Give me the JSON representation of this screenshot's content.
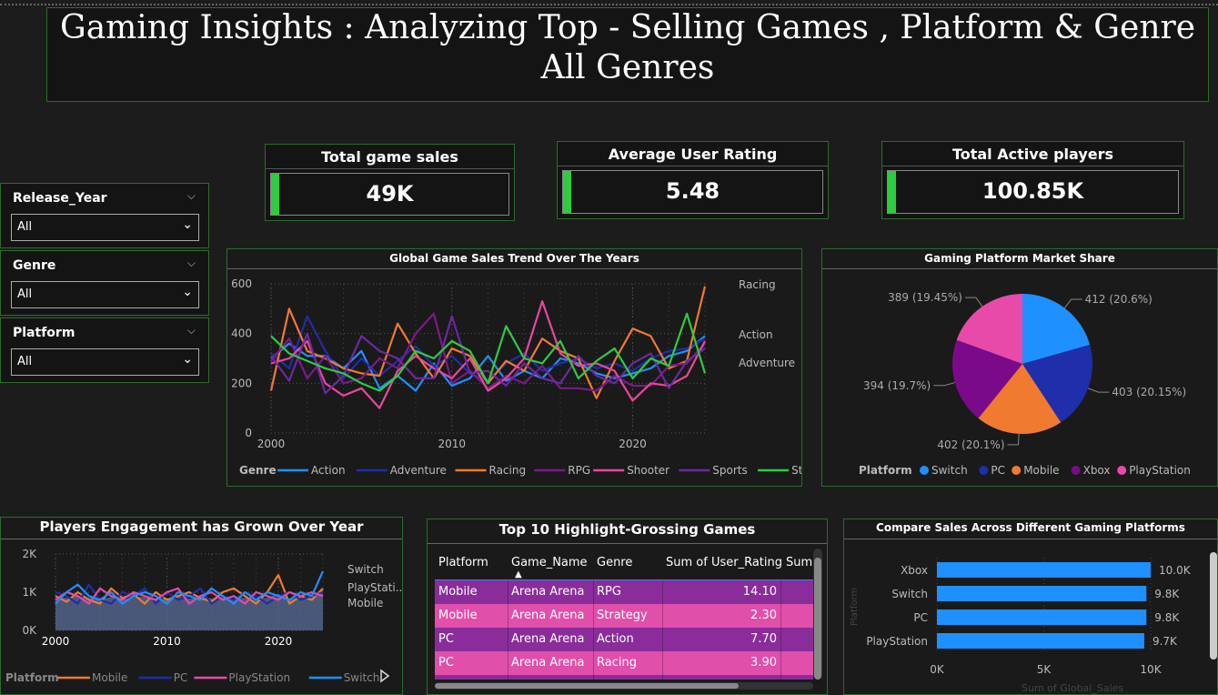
{
  "header": {
    "title_line1": "Gaming Insights : Analyzing Top - Selling Games , Platform & Genre",
    "title_line2": "All Genres"
  },
  "kpis": [
    {
      "label": "Total game sales",
      "value": "49K",
      "accent": "#2ecc40"
    },
    {
      "label": "Average User Rating",
      "value": "5.48",
      "accent": "#2ecc40"
    },
    {
      "label": "Total Active players",
      "value": "100.85K",
      "accent": "#2ecc40"
    }
  ],
  "slicers": [
    {
      "title": "Release_Year",
      "value": "All"
    },
    {
      "title": "Genre",
      "value": "All"
    },
    {
      "title": "Platform",
      "value": "All"
    }
  ],
  "trend_chart": {
    "title": "Global Game Sales Trend Over The Years",
    "legend_title": "Genre",
    "series_labels": [
      "Racing",
      "Action",
      "Adventure"
    ],
    "chart_data": {
      "type": "line",
      "title": "Global Game Sales Trend Over The Years",
      "x": [
        2000,
        2001,
        2002,
        2003,
        2004,
        2005,
        2006,
        2007,
        2008,
        2009,
        2010,
        2011,
        2012,
        2013,
        2014,
        2015,
        2016,
        2017,
        2018,
        2019,
        2020,
        2021,
        2022,
        2023,
        2024
      ],
      "xticks": [
        "2000",
        "2010",
        "2020"
      ],
      "yticks": [
        "0",
        "200",
        "400",
        "600"
      ],
      "ylim": [
        0,
        600
      ],
      "series": [
        {
          "name": "Action",
          "color": "#1e90ff",
          "values": [
            300,
            360,
            310,
            310,
            260,
            330,
            180,
            230,
            170,
            280,
            190,
            220,
            310,
            210,
            250,
            220,
            300,
            280,
            240,
            220,
            240,
            260,
            310,
            330,
            390
          ]
        },
        {
          "name": "Adventure",
          "color": "#1f2eaa",
          "values": [
            320,
            260,
            470,
            330,
            220,
            300,
            230,
            290,
            350,
            270,
            310,
            240,
            210,
            280,
            320,
            250,
            280,
            300,
            260,
            280,
            250,
            300,
            330,
            340,
            380
          ]
        },
        {
          "name": "Racing",
          "color": "#f07a30",
          "values": [
            170,
            500,
            330,
            300,
            260,
            240,
            230,
            440,
            320,
            220,
            340,
            310,
            200,
            290,
            250,
            380,
            330,
            300,
            140,
            290,
            420,
            390,
            260,
            290,
            590
          ]
        },
        {
          "name": "RPG",
          "color": "#7b1a8a",
          "values": [
            290,
            380,
            220,
            310,
            200,
            220,
            300,
            260,
            400,
            480,
            200,
            250,
            180,
            230,
            200,
            270,
            180,
            180,
            170,
            230,
            190,
            190,
            270,
            280,
            360
          ]
        },
        {
          "name": "Shooter",
          "color": "#e8479e",
          "values": [
            280,
            300,
            370,
            200,
            150,
            180,
            100,
            250,
            310,
            260,
            220,
            300,
            170,
            220,
            300,
            530,
            320,
            270,
            280,
            250,
            130,
            200,
            190,
            230,
            370
          ]
        },
        {
          "name": "Sports",
          "color": "#6a2aa0",
          "values": [
            310,
            210,
            400,
            160,
            230,
            390,
            330,
            300,
            220,
            220,
            470,
            240,
            250,
            190,
            280,
            220,
            200,
            310,
            230,
            200,
            280,
            320,
            180,
            290,
            340
          ]
        },
        {
          "name": "Strategy",
          "color": "#2ecc40",
          "values": [
            390,
            320,
            290,
            260,
            240,
            200,
            170,
            230,
            330,
            300,
            370,
            330,
            200,
            430,
            300,
            280,
            370,
            220,
            290,
            340,
            220,
            300,
            270,
            480,
            240
          ]
        }
      ]
    }
  },
  "pie_chart": {
    "title": "Gaming Platform Market Share",
    "legend_title": "Platform",
    "chart_data": {
      "type": "pie",
      "title": "Gaming Platform Market Share",
      "slices": [
        {
          "name": "Switch",
          "value": 412,
          "label": "412 (20.6%)",
          "color": "#1e90ff"
        },
        {
          "name": "PC",
          "value": 403,
          "label": "403 (20.15%)",
          "color": "#1f2eaa"
        },
        {
          "name": "Mobile",
          "value": 402,
          "label": "402 (20.1%)",
          "color": "#f07a30"
        },
        {
          "name": "Xbox",
          "value": 394,
          "label": "394 (19.7%)",
          "color": "#7b0a8a"
        },
        {
          "name": "PlayStation",
          "value": 389,
          "label": "389 (19.45%)",
          "color": "#e84aaa"
        }
      ]
    }
  },
  "engagement_chart": {
    "title": "Players Engagement has Grown Over Year",
    "legend_title": "Platform",
    "series_labels": [
      "Switch",
      "PlayStati...",
      "Mobile"
    ],
    "chart_data": {
      "type": "line",
      "title": "Players Engagement has Grown Over Year",
      "x": [
        2000,
        2001,
        2002,
        2003,
        2004,
        2005,
        2006,
        2007,
        2008,
        2009,
        2010,
        2011,
        2012,
        2013,
        2014,
        2015,
        2016,
        2017,
        2018,
        2019,
        2020,
        2021,
        2022,
        2023,
        2024
      ],
      "xticks": [
        "2000",
        "2010",
        "2020"
      ],
      "yticks": [
        "0K",
        "1K",
        "2K"
      ],
      "ylim": [
        0,
        2000
      ],
      "series": [
        {
          "name": "Mobile",
          "color": "#f07a30",
          "values": [
            900,
            750,
            1000,
            800,
            700,
            1100,
            850,
            950,
            700,
            1000,
            800,
            900,
            1000,
            850,
            750,
            1000,
            1100,
            900,
            700,
            1000,
            1450,
            700,
            900,
            800,
            1100
          ]
        },
        {
          "name": "PC",
          "color": "#1f2eaa",
          "values": [
            1000,
            900,
            700,
            1200,
            800,
            700,
            1000,
            900,
            1100,
            700,
            1000,
            800,
            900,
            1100,
            700,
            900,
            800,
            1000,
            900,
            700,
            900,
            1000,
            800,
            900,
            1000
          ]
        },
        {
          "name": "PlayStation",
          "color": "#e84aaa",
          "values": [
            800,
            1000,
            900,
            700,
            1100,
            900,
            800,
            1000,
            900,
            800,
            1000,
            1100,
            700,
            900,
            1000,
            800,
            900,
            700,
            1000,
            900,
            800,
            1000,
            900,
            1000,
            900
          ]
        },
        {
          "name": "Switch",
          "color": "#1e90ff",
          "values": [
            700,
            1000,
            1200,
            900,
            800,
            1000,
            700,
            900,
            1000,
            900,
            700,
            1000,
            900,
            800,
            1100,
            900,
            700,
            1000,
            800,
            1000,
            900,
            800,
            1000,
            900,
            1550
          ]
        }
      ]
    }
  },
  "top_games": {
    "title": "Top 10 Highlight-Grossing Games",
    "columns": [
      "Platform",
      "Game_Name",
      "Genre",
      "Sum of User_Rating",
      "Sum"
    ],
    "rows": [
      {
        "platform": "Mobile",
        "game": "Arena Arena",
        "genre": "RPG",
        "rating": "14.10",
        "color": "#8a2d9a"
      },
      {
        "platform": "Mobile",
        "game": "Arena Arena",
        "genre": "Strategy",
        "rating": "2.30",
        "color": "#e04faa"
      },
      {
        "platform": "PC",
        "game": "Arena Arena",
        "genre": "Action",
        "rating": "7.70",
        "color": "#8a2d9a"
      },
      {
        "platform": "PC",
        "game": "Arena Arena",
        "genre": "Racing",
        "rating": "3.90",
        "color": "#e04faa"
      }
    ]
  },
  "platform_bar": {
    "title": "Compare Sales Across Different Gaming Platforms",
    "ylabel": "Platform",
    "xlabel": "Sum of Global_Sales",
    "chart_data": {
      "type": "bar",
      "title": "Compare Sales Across Different Gaming Platforms",
      "categories": [
        "Xbox",
        "Switch",
        "PC",
        "PlayStation"
      ],
      "values": [
        10000,
        9800,
        9800,
        9700
      ],
      "data_labels": [
        "10.0K",
        "9.8K",
        "9.8K",
        "9.7K"
      ],
      "xticks": [
        "0K",
        "5K",
        "10K"
      ],
      "xlim": [
        0,
        10000
      ],
      "color": "#1e90ff"
    }
  }
}
